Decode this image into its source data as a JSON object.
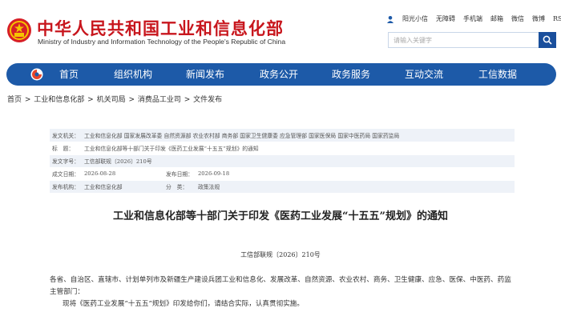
{
  "header": {
    "title": "中华人民共和国工业和信息化部",
    "subtitle": "Ministry of Industry and Information Technology of the People's Republic of China",
    "top_links": [
      "阳光小信",
      "无障碍",
      "手机端",
      "邮箱",
      "微信",
      "微博",
      "RSS订阅"
    ],
    "search_placeholder": "请输入关键字"
  },
  "nav": {
    "items": [
      "首页",
      "组织机构",
      "新闻发布",
      "政务公开",
      "政务服务",
      "互动交流",
      "工信数据"
    ]
  },
  "breadcrumb": [
    "首页",
    "工业和信息化部",
    "机关司局",
    "消费品工业司",
    "文件发布"
  ],
  "meta": {
    "issuer_label": "发文机关：",
    "issuer_value": "工业和信息化部 国家发展改革委 自然资源部 农业农村部 商务部 国家卫生健康委 应急管理部 国家医保局 国家中医药局 国家药监局",
    "title_label": "标　题：",
    "title_value": "工业和信息化部等十部门关于印发《医药工业发展“十五五”规划》的通知",
    "docno_label": "发文字号：",
    "docno_value": "工信部联规〔2026〕210号",
    "created_label": "成文日期：",
    "created_value": "2026-08-28",
    "published_label": "发布日期：",
    "published_value": "2026-09-18",
    "org_label": "发布机构：",
    "org_value": "工业和信息化部",
    "category_label": "分　类：",
    "category_value": "政策法规"
  },
  "article": {
    "title": "工业和信息化部等十部门关于印发《医药工业发展“十五五”规划》的通知",
    "doc_no": "工信部联规〔2026〕210号",
    "para1": "各省、自治区、直辖市、计划单列市及新疆生产建设兵团工业和信息化、发展改革、自然资源、农业农村、商务、卫生健康、应急、医保、中医药、药监主管部门：",
    "para2": "现将《医药工业发展“十五五”规划》印发给你们，请结合实际，认真贯彻实施。"
  },
  "colors": {
    "brand_red": "#c8161d",
    "nav_blue": "#1d5aa8",
    "meta_row": "#eef2f8"
  }
}
